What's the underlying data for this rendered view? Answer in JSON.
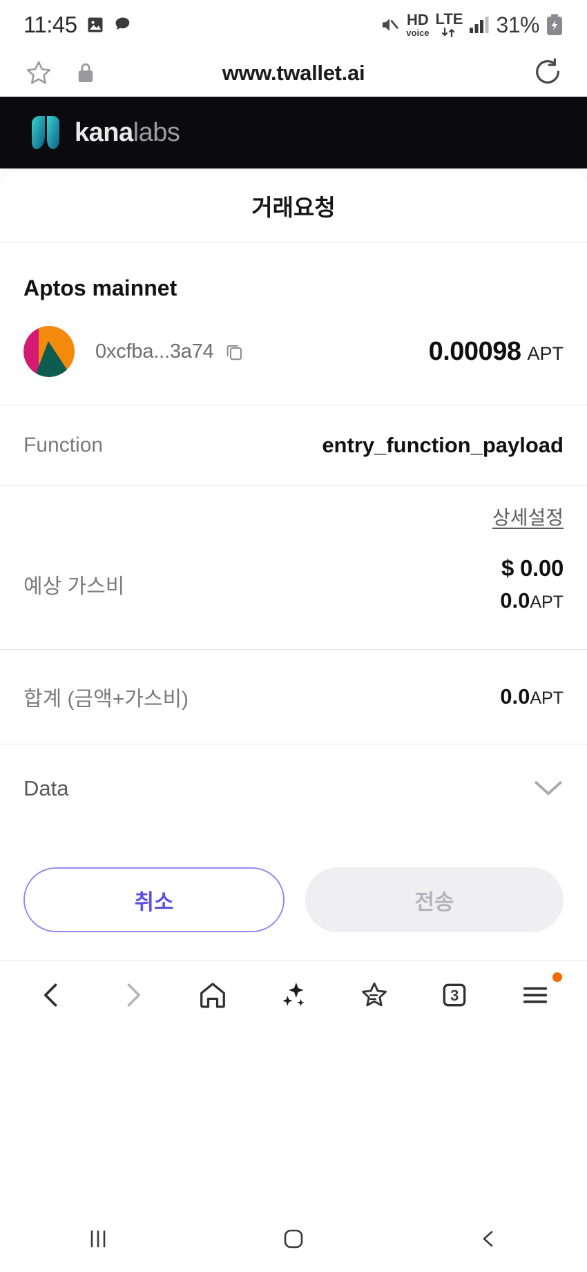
{
  "statusbar": {
    "time": "11:45",
    "icons_left": [
      "image-icon",
      "contacts-icon"
    ],
    "icons_right": [
      "mute-icon",
      "hd-voice-icon",
      "lte-icon",
      "signal-icon"
    ],
    "hd_label": "HD",
    "hd_sub": "voice",
    "lte_label": "LTE",
    "battery_percent": "31%",
    "battery_state": "charging"
  },
  "browser": {
    "url": "www.twallet.ai",
    "star_icon": "star-outline-icon",
    "lock_icon": "lock-icon",
    "reload_icon": "reload-icon",
    "nav": {
      "back": "back-arrow-icon",
      "forward": "forward-arrow-icon",
      "home": "home-icon",
      "assistant": "sparkle-icon",
      "bookmarks": "bookmark-star-icon",
      "tabs_icon": "tabs-icon",
      "tabs_count": "3",
      "menu": "hamburger-menu-icon",
      "menu_badge": true
    }
  },
  "site_header": {
    "brand_bold": "kana",
    "brand_light": "labs",
    "logo_icon": "kanalabs-logo-icon",
    "background": "#0b0b0d",
    "logo_color_start": "#2ec4c4",
    "logo_color_end": "#0f6d8f"
  },
  "modal": {
    "title": "거래요청",
    "network": "Aptos mainnet",
    "account": {
      "avatar_icon": "account-identicon",
      "avatar_colors": [
        "#d61a73",
        "#f28b0c",
        "#0d5c4f"
      ],
      "address": "0xcfba...3a74",
      "copy_icon": "copy-icon",
      "amount_value": "0.00098",
      "amount_unit": "APT"
    },
    "function": {
      "label": "Function",
      "value": "entry_function_payload"
    },
    "gas": {
      "settings_link": "상세설정",
      "label": "예상 가스비",
      "usd": "$ 0.00",
      "native_value": "0.0",
      "native_unit": "APT"
    },
    "total": {
      "label": "합계 (금액+가스비)",
      "value": "0.0",
      "unit": "APT"
    },
    "data_section": {
      "label": "Data",
      "chevron_icon": "chevron-down-icon"
    },
    "buttons": {
      "cancel": "취소",
      "submit": "전송",
      "cancel_color": "#5a51e0",
      "submit_color": "#b4b4ba"
    }
  },
  "sysnav": {
    "recents": "recents-icon",
    "home": "home-square-icon",
    "back": "back-chevron-icon"
  }
}
